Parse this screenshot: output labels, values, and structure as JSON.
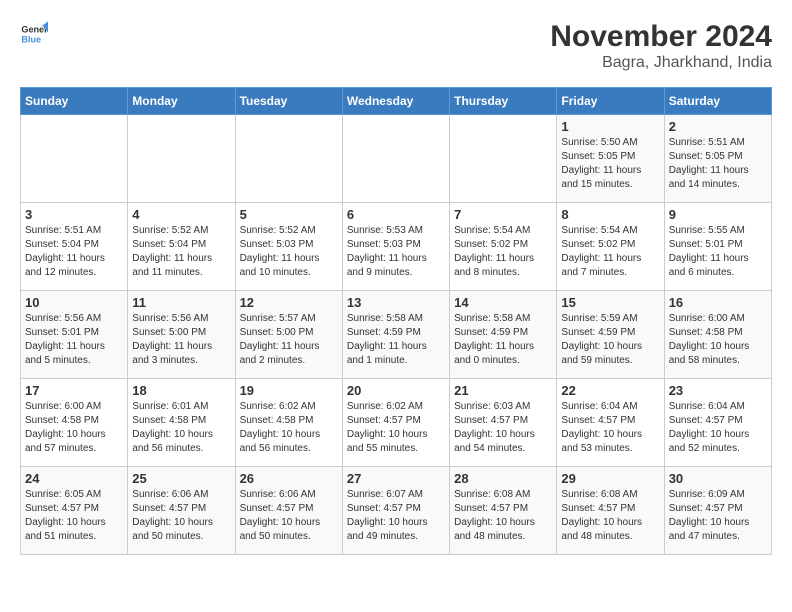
{
  "logo": {
    "general": "General",
    "blue": "Blue"
  },
  "title": "November 2024",
  "location": "Bagra, Jharkhand, India",
  "days_of_week": [
    "Sunday",
    "Monday",
    "Tuesday",
    "Wednesday",
    "Thursday",
    "Friday",
    "Saturday"
  ],
  "weeks": [
    [
      {
        "day": "",
        "info": ""
      },
      {
        "day": "",
        "info": ""
      },
      {
        "day": "",
        "info": ""
      },
      {
        "day": "",
        "info": ""
      },
      {
        "day": "",
        "info": ""
      },
      {
        "day": "1",
        "info": "Sunrise: 5:50 AM\nSunset: 5:05 PM\nDaylight: 11 hours and 15 minutes."
      },
      {
        "day": "2",
        "info": "Sunrise: 5:51 AM\nSunset: 5:05 PM\nDaylight: 11 hours and 14 minutes."
      }
    ],
    [
      {
        "day": "3",
        "info": "Sunrise: 5:51 AM\nSunset: 5:04 PM\nDaylight: 11 hours and 12 minutes."
      },
      {
        "day": "4",
        "info": "Sunrise: 5:52 AM\nSunset: 5:04 PM\nDaylight: 11 hours and 11 minutes."
      },
      {
        "day": "5",
        "info": "Sunrise: 5:52 AM\nSunset: 5:03 PM\nDaylight: 11 hours and 10 minutes."
      },
      {
        "day": "6",
        "info": "Sunrise: 5:53 AM\nSunset: 5:03 PM\nDaylight: 11 hours and 9 minutes."
      },
      {
        "day": "7",
        "info": "Sunrise: 5:54 AM\nSunset: 5:02 PM\nDaylight: 11 hours and 8 minutes."
      },
      {
        "day": "8",
        "info": "Sunrise: 5:54 AM\nSunset: 5:02 PM\nDaylight: 11 hours and 7 minutes."
      },
      {
        "day": "9",
        "info": "Sunrise: 5:55 AM\nSunset: 5:01 PM\nDaylight: 11 hours and 6 minutes."
      }
    ],
    [
      {
        "day": "10",
        "info": "Sunrise: 5:56 AM\nSunset: 5:01 PM\nDaylight: 11 hours and 5 minutes."
      },
      {
        "day": "11",
        "info": "Sunrise: 5:56 AM\nSunset: 5:00 PM\nDaylight: 11 hours and 3 minutes."
      },
      {
        "day": "12",
        "info": "Sunrise: 5:57 AM\nSunset: 5:00 PM\nDaylight: 11 hours and 2 minutes."
      },
      {
        "day": "13",
        "info": "Sunrise: 5:58 AM\nSunset: 4:59 PM\nDaylight: 11 hours and 1 minute."
      },
      {
        "day": "14",
        "info": "Sunrise: 5:58 AM\nSunset: 4:59 PM\nDaylight: 11 hours and 0 minutes."
      },
      {
        "day": "15",
        "info": "Sunrise: 5:59 AM\nSunset: 4:59 PM\nDaylight: 10 hours and 59 minutes."
      },
      {
        "day": "16",
        "info": "Sunrise: 6:00 AM\nSunset: 4:58 PM\nDaylight: 10 hours and 58 minutes."
      }
    ],
    [
      {
        "day": "17",
        "info": "Sunrise: 6:00 AM\nSunset: 4:58 PM\nDaylight: 10 hours and 57 minutes."
      },
      {
        "day": "18",
        "info": "Sunrise: 6:01 AM\nSunset: 4:58 PM\nDaylight: 10 hours and 56 minutes."
      },
      {
        "day": "19",
        "info": "Sunrise: 6:02 AM\nSunset: 4:58 PM\nDaylight: 10 hours and 56 minutes."
      },
      {
        "day": "20",
        "info": "Sunrise: 6:02 AM\nSunset: 4:57 PM\nDaylight: 10 hours and 55 minutes."
      },
      {
        "day": "21",
        "info": "Sunrise: 6:03 AM\nSunset: 4:57 PM\nDaylight: 10 hours and 54 minutes."
      },
      {
        "day": "22",
        "info": "Sunrise: 6:04 AM\nSunset: 4:57 PM\nDaylight: 10 hours and 53 minutes."
      },
      {
        "day": "23",
        "info": "Sunrise: 6:04 AM\nSunset: 4:57 PM\nDaylight: 10 hours and 52 minutes."
      }
    ],
    [
      {
        "day": "24",
        "info": "Sunrise: 6:05 AM\nSunset: 4:57 PM\nDaylight: 10 hours and 51 minutes."
      },
      {
        "day": "25",
        "info": "Sunrise: 6:06 AM\nSunset: 4:57 PM\nDaylight: 10 hours and 50 minutes."
      },
      {
        "day": "26",
        "info": "Sunrise: 6:06 AM\nSunset: 4:57 PM\nDaylight: 10 hours and 50 minutes."
      },
      {
        "day": "27",
        "info": "Sunrise: 6:07 AM\nSunset: 4:57 PM\nDaylight: 10 hours and 49 minutes."
      },
      {
        "day": "28",
        "info": "Sunrise: 6:08 AM\nSunset: 4:57 PM\nDaylight: 10 hours and 48 minutes."
      },
      {
        "day": "29",
        "info": "Sunrise: 6:08 AM\nSunset: 4:57 PM\nDaylight: 10 hours and 48 minutes."
      },
      {
        "day": "30",
        "info": "Sunrise: 6:09 AM\nSunset: 4:57 PM\nDaylight: 10 hours and 47 minutes."
      }
    ]
  ]
}
